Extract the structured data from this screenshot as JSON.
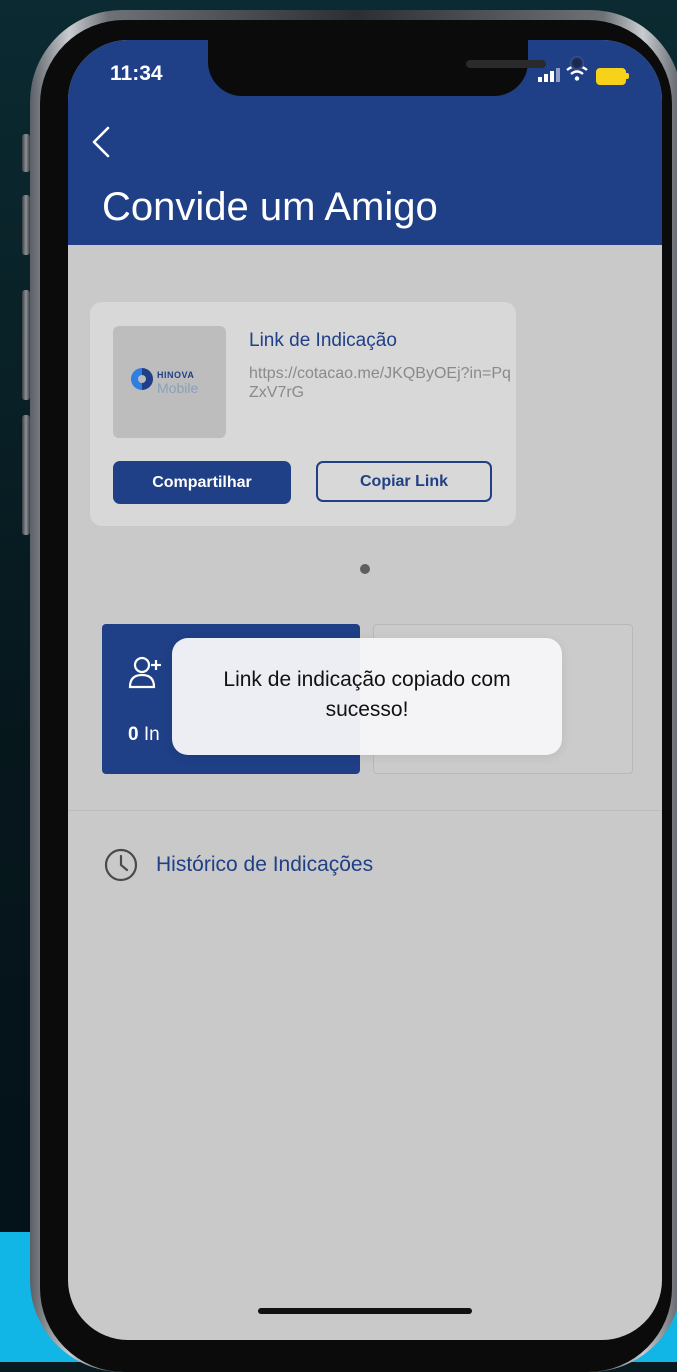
{
  "status_bar": {
    "time": "11:34"
  },
  "header": {
    "title": "Convide um Amigo",
    "back_icon": "chevron-left-icon"
  },
  "referral_card": {
    "logo_top": "HINOVA",
    "logo_bottom": "Mobile",
    "title": "Link de Indicação",
    "url": "https://cotacao.me/JKQByOEj?in=PqZxV7rG",
    "share_label": "Compartilhar",
    "copy_label": "Copiar Link"
  },
  "stats": {
    "count": "0",
    "label_visible": "In"
  },
  "toast": {
    "message": "Link de indicação copiado com sucesso!"
  },
  "history": {
    "label": "Histórico de Indicações",
    "icon": "clock-icon"
  },
  "colors": {
    "primary": "#1f3f86",
    "background": "#c9c9c9",
    "accent_cyan": "#12b6e6"
  }
}
